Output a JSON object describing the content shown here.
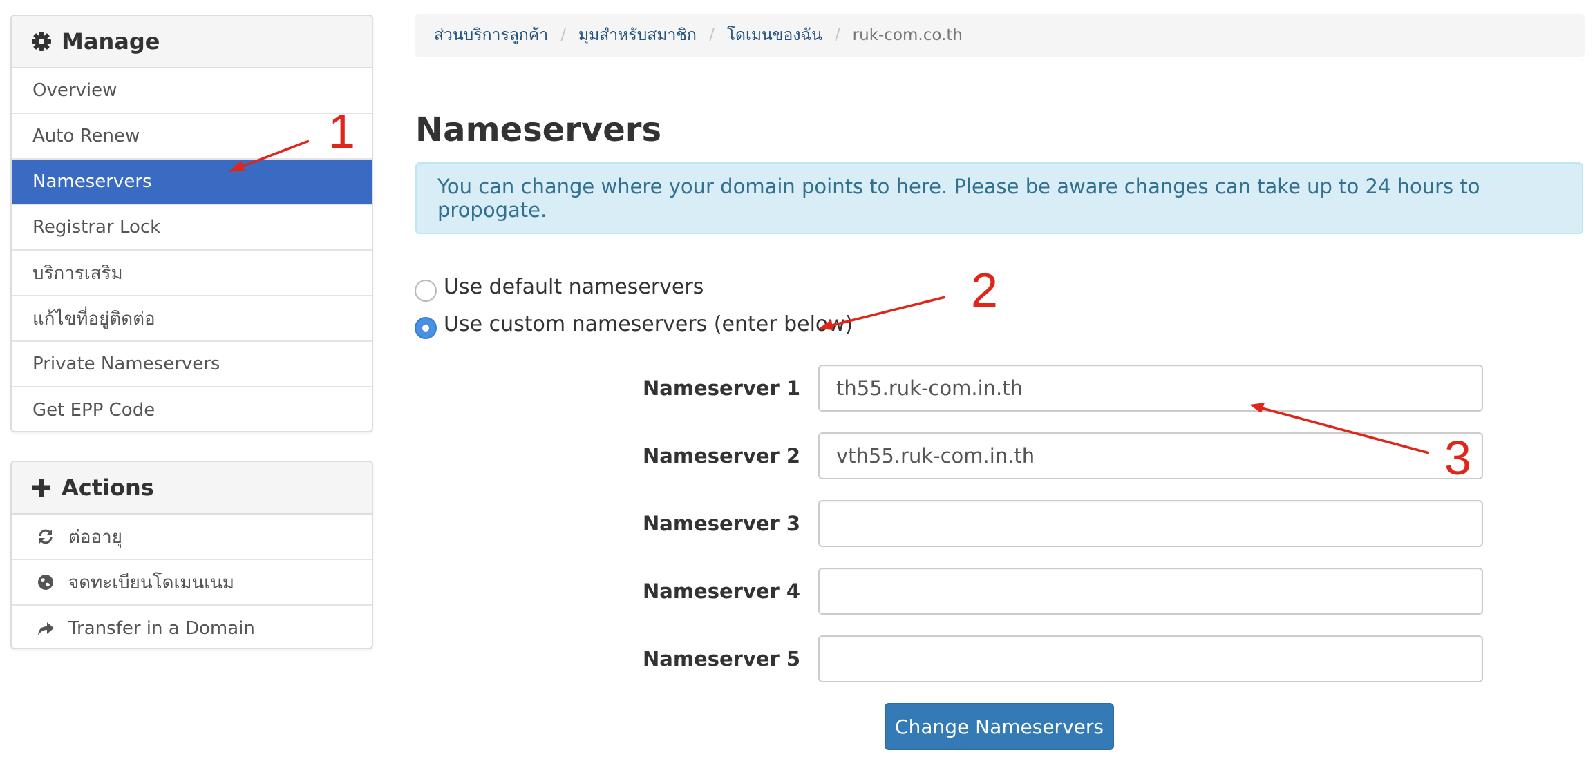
{
  "sidebar": {
    "manage": {
      "title": "Manage",
      "icon": "gear-icon",
      "items": [
        {
          "label": "Overview",
          "active": false
        },
        {
          "label": "Auto Renew",
          "active": false
        },
        {
          "label": "Nameservers",
          "active": true
        },
        {
          "label": "Registrar Lock",
          "active": false
        },
        {
          "label": "บริการเสริม",
          "active": false
        },
        {
          "label": "แก้ไขที่อยู่ติดต่อ",
          "active": false
        },
        {
          "label": "Private Nameservers",
          "active": false
        },
        {
          "label": "Get EPP Code",
          "active": false
        }
      ]
    },
    "actions": {
      "title": "Actions",
      "icon": "plus-icon",
      "items": [
        {
          "label": "ต่ออายุ",
          "icon": "refresh-icon"
        },
        {
          "label": "จดทะเบียนโดเมนเนม",
          "icon": "globe-icon"
        },
        {
          "label": "Transfer in a Domain",
          "icon": "share-arrow-icon"
        }
      ]
    }
  },
  "breadcrumb": {
    "items": [
      "ส่วนบริการลูกค้า",
      "มุมสำหรับสมาชิก",
      "โดเมนของฉัน",
      "ruk-com.co.th"
    ],
    "separator": "/"
  },
  "main": {
    "title": "Nameservers",
    "alert": "You can change where your domain points to here. Please be aware changes can take up to 24 hours to propogate.",
    "options": {
      "default_label": "Use default nameservers",
      "custom_label": "Use custom nameservers (enter below)",
      "selected": "custom"
    },
    "nameservers": [
      {
        "label": "Nameserver 1",
        "value": "th55.ruk-com.in.th"
      },
      {
        "label": "Nameserver 2",
        "value": "vth55.ruk-com.in.th"
      },
      {
        "label": "Nameserver 3",
        "value": ""
      },
      {
        "label": "Nameserver 4",
        "value": ""
      },
      {
        "label": "Nameserver 5",
        "value": ""
      }
    ],
    "submit_label": "Change Nameservers"
  },
  "annotations": {
    "numbers": [
      "1",
      "2",
      "3"
    ],
    "color": "#e0261b"
  },
  "colors": {
    "active_item": "#3a6bc3",
    "link": "#23527c",
    "alert_bg": "#d9edf7",
    "alert_text": "#31708f",
    "primary_button": "#337ab7",
    "radio_checked": "#4a90e2"
  }
}
